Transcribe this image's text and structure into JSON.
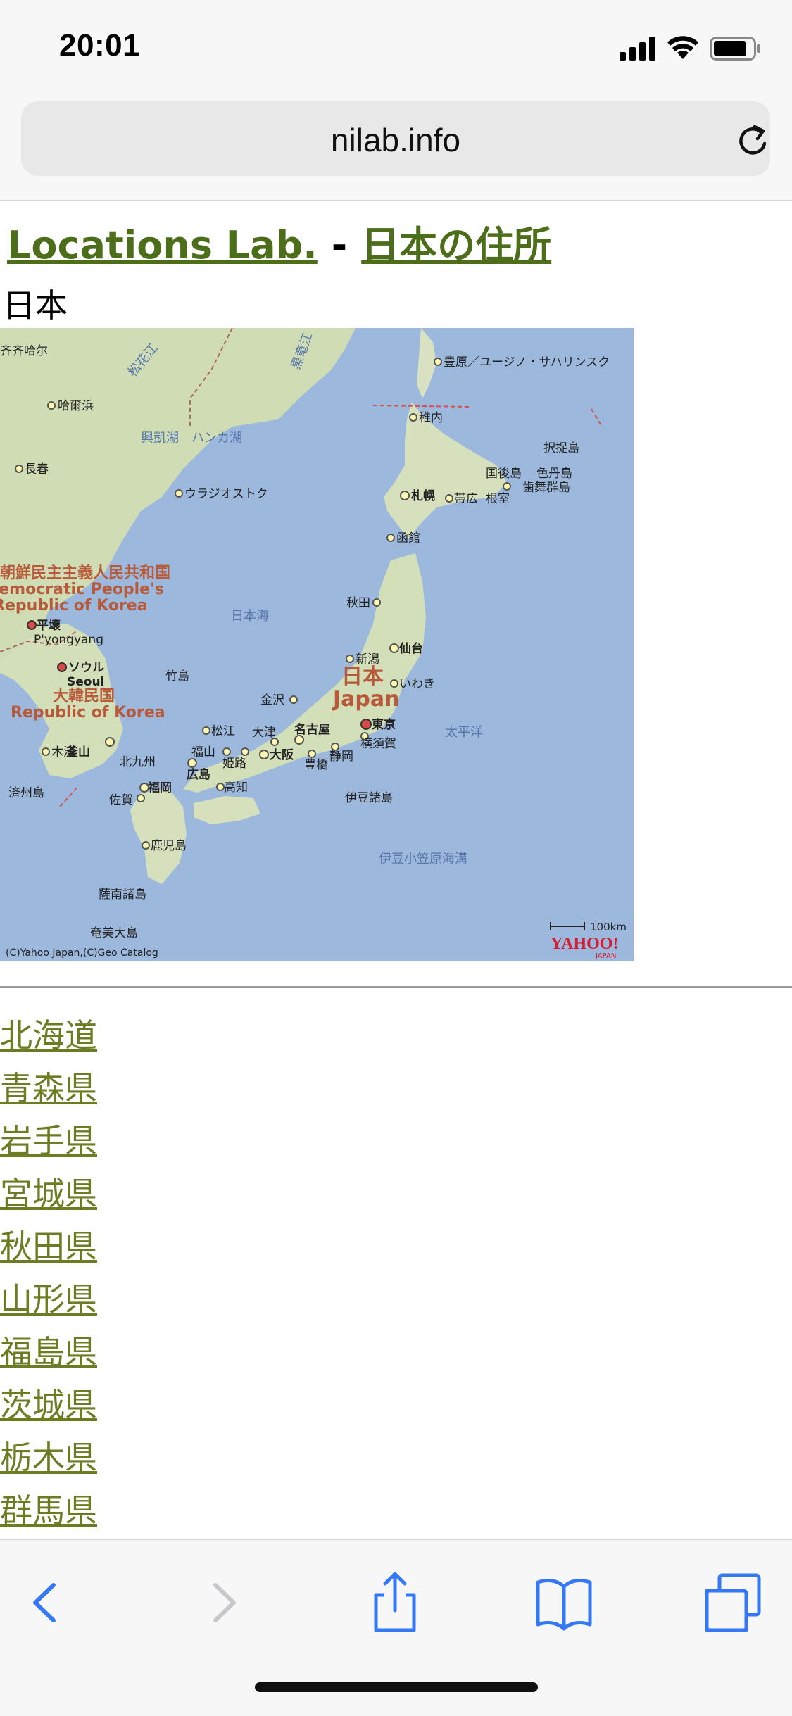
{
  "status": {
    "time": "20:01"
  },
  "browser": {
    "url": "nilab.info"
  },
  "page": {
    "site_title": "Locations Lab.",
    "separator": "-",
    "section_title": "日本の住所",
    "country": "日本"
  },
  "map": {
    "labels": {
      "qiqihar": "齐齐哈尔",
      "harbin": "哈爾浜",
      "changchun": "長春",
      "xingkai": "興凱湖",
      "khanka": "ハンカ湖",
      "vladivostok": "ウラジオストク",
      "heilongjiang": "松花江",
      "ussuri": "黒竜江",
      "dprk_ja": "朝鮮民主主義人民共和国",
      "dprk_en1": "Democratic People's",
      "dprk_en2": "Republic of Korea",
      "pyongyang_ja": "平壌",
      "pyongyang_en": "P'yongyang",
      "seoul_ja": "ソウル",
      "seoul_en": "Seoul",
      "rok_ja": "大韓民国",
      "rok_en": "Republic of Korea",
      "busan": "釜山",
      "muko": "木浦",
      "jeju": "済州島",
      "sea_of_japan": "日本海",
      "takeshima": "竹島",
      "yuzhno": "豊原／ユージノ・サハリンスク",
      "wakkanai": "稚内",
      "sapporo": "札幌",
      "obihiro": "帯広",
      "nemuro": "根室",
      "kunashiri": "国後島",
      "shikotan": "色丹島",
      "habomai": "歯舞群島",
      "etorofu": "択捉島",
      "hakodate": "函館",
      "akita": "秋田",
      "sendai": "仙台",
      "niigata": "新潟",
      "iwaki": "いわき",
      "japan_ja": "日本",
      "japan_en": "Japan",
      "kanazawa": "金沢",
      "matsue": "松江",
      "otsu": "大津",
      "nagoya": "名古屋",
      "tokyo": "東京",
      "fukuyama": "福山",
      "himeji": "姫路",
      "osaka": "大阪",
      "yokosuka": "横須賀",
      "kitakyushu": "北九州",
      "hiroshima": "広島",
      "toyohashi": "豊橋",
      "shizuoka": "静岡",
      "fukuoka": "福岡",
      "kochi": "高知",
      "saga": "佐賀",
      "pacific": "太平洋",
      "izu": "伊豆諸島",
      "kagoshima": "鹿児島",
      "ogasawara": "伊豆小笠原海溝",
      "nansei": "薩南諸島",
      "amami": "奄美大島",
      "scale": "100km",
      "copyright": "(C)Yahoo Japan,(C)Geo Catalog",
      "logo": "YAHOO!",
      "logo_sub": "JAPAN"
    }
  },
  "prefectures": [
    "北海道",
    "青森県",
    "岩手県",
    "宮城県",
    "秋田県",
    "山形県",
    "福島県",
    "茨城県",
    "栃木県",
    "群馬県"
  ],
  "colors": {
    "link_title": "#4c6e1a",
    "link_list": "#6b7d22",
    "accent_ios": "#3478f6",
    "sea": "#9cb8dc"
  },
  "toolbar": {
    "back_icon": "chevron-left-icon",
    "forward_icon": "chevron-right-icon",
    "share_icon": "share-icon",
    "bookmarks_icon": "book-icon",
    "tabs_icon": "tabs-icon"
  }
}
